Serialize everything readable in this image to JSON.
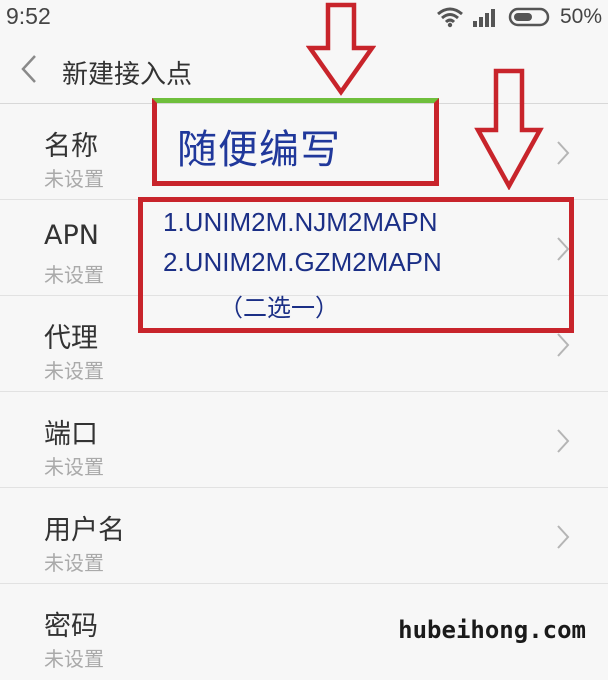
{
  "status_bar": {
    "time": "9:52",
    "battery_percent": "50%"
  },
  "header": {
    "title": "新建接入点"
  },
  "rows": [
    {
      "label": "名称",
      "value": "未设置"
    },
    {
      "label": "APN",
      "value": "未设置"
    },
    {
      "label": "代理",
      "value": "未设置"
    },
    {
      "label": "端口",
      "value": "未设置"
    },
    {
      "label": "用户名",
      "value": "未设置"
    },
    {
      "label": "密码",
      "value": "未设置"
    }
  ],
  "annotations": {
    "name_hint": "随便编写",
    "apn_line1": "1.UNIM2M.NJM2MAPN",
    "apn_line2": "2.UNIM2M.GZM2MAPN",
    "apn_line3": "（二选一）"
  },
  "watermark": "hubeihong.com",
  "colors": {
    "annotation_red": "#c8242b",
    "annotation_text": "#1b2f86",
    "background": "#f7f7f7"
  }
}
